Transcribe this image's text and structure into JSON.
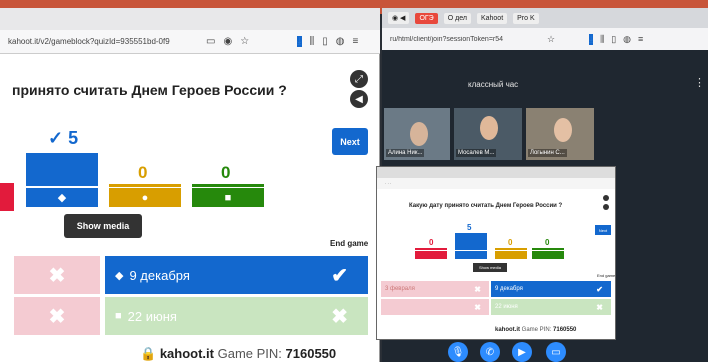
{
  "left": {
    "url": "kahoot.it/v2/gameblock?quizId=935551bd-0f9",
    "question": "принято считать Днем Героев России ?",
    "counts": [
      "5",
      "0",
      "0"
    ],
    "check_mark": "✓",
    "next_label": "Next",
    "show_media_label": "Show media",
    "end_game_label": "End game",
    "answers": [
      {
        "label": "",
        "correct": false,
        "color": "#f4cbd2"
      },
      {
        "label": "9 декабря",
        "correct": true,
        "color": "#1368ce"
      },
      {
        "label": "",
        "correct": false,
        "color": "#f4cbd2"
      },
      {
        "label": "22 июня",
        "correct": false,
        "color": "#c9e5c0"
      }
    ],
    "footer_site": "kahoot.it",
    "footer_pin_label": "Game PIN:",
    "footer_pin": "7160550"
  },
  "right": {
    "tabs": [
      "ОГЭ",
      "О дел",
      "Kahoot",
      "Pro K"
    ],
    "url": "ru/html/client/join?sessionToken=r54",
    "meeting_title": "классный час",
    "participants": [
      {
        "name": "Алина Ник..."
      },
      {
        "name": "Мосалев М..."
      },
      {
        "name": "Логынин С..."
      }
    ],
    "share": {
      "question": "Какую дату принято считать Днем Героев России ?",
      "counts": [
        "0",
        "5",
        "0",
        "0"
      ],
      "next_label": "Next",
      "show_media_label": "Show media",
      "end_game_label": "End game",
      "answers": [
        {
          "label": "3 февраля"
        },
        {
          "label": "9 декабря"
        },
        {
          "label": ""
        },
        {
          "label": "22 июня"
        }
      ],
      "footer_site": "kahoot.it",
      "footer_pin_label": "Game PIN:",
      "footer_pin": "7160550"
    }
  },
  "icons": [
    "download-icon",
    "library-icon",
    "sidebar-icon",
    "account-icon",
    "menu-icon",
    "fullscreen-icon",
    "volume-icon",
    "mic-icon",
    "phone-icon",
    "camera-icon",
    "screen-share-icon"
  ]
}
